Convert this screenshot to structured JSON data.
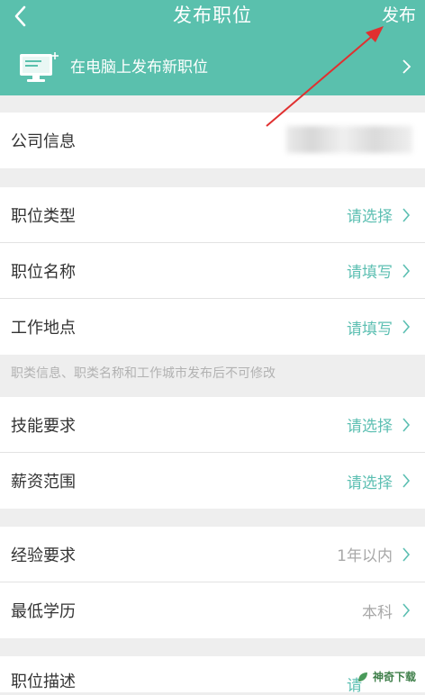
{
  "header": {
    "title": "发布职位",
    "publish_label": "发布"
  },
  "banner": {
    "text": "在电脑上发布新职位"
  },
  "company": {
    "label": "公司信息"
  },
  "rows_group1": [
    {
      "label": "职位类型",
      "value": "请选择"
    },
    {
      "label": "职位名称",
      "value": "请填写"
    },
    {
      "label": "工作地点",
      "value": "请填写"
    }
  ],
  "note": "职类信息、职类名称和工作城市发布后不可修改",
  "rows_group2": [
    {
      "label": "技能要求",
      "value": "请选择"
    },
    {
      "label": "薪资范围",
      "value": "请选择"
    }
  ],
  "rows_group3": [
    {
      "label": "经验要求",
      "value": "1年以内"
    },
    {
      "label": "最低学历",
      "value": "本科"
    }
  ],
  "rows_group4": [
    {
      "label": "职位描述",
      "value": "请"
    }
  ],
  "watermark": "神奇下载",
  "colors": {
    "accent": "#5ac0ad",
    "placeholder": "#5cbfb2",
    "filled": "#a8a8a8",
    "annotation": "#e03030"
  }
}
